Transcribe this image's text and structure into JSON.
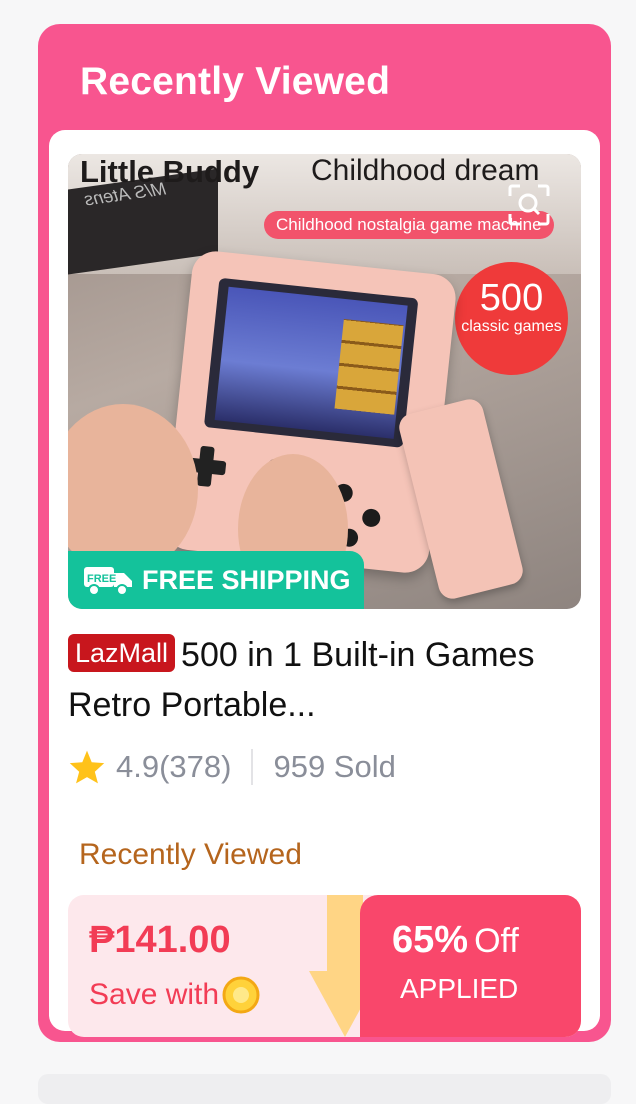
{
  "section": {
    "title": "Recently Viewed"
  },
  "product": {
    "image_brand_text": "Little Buddy",
    "image_tagline": "Childhood dream",
    "image_pill": "Childhood nostalgia game machine",
    "image_box_text": "M/S Atens",
    "image_badge_number": "500",
    "image_badge_text": "classic games",
    "free_shipping": "FREE SHIPPING",
    "truck_badge_text": "FREE",
    "lazmall_badge": "LazMall",
    "title": "500 in 1 Built-in Games Retro Portable...",
    "rating": "4.9(378)",
    "sold": "959 Sold",
    "recently_viewed_label": "Recently Viewed",
    "price": "₱141.00",
    "save_with": "Save with",
    "discount_percent": "65%",
    "discount_off": "Off",
    "discount_status": "APPLIED"
  },
  "colors": {
    "card": "#f8558f",
    "lazmall": "#c8161d",
    "free_shipping": "#14c29b",
    "price": "#f23c55",
    "discount_bg": "#f9476b"
  },
  "icons": [
    "zoom-icon",
    "truck-icon",
    "star-icon",
    "coin-icon",
    "down-arrow-icon"
  ]
}
